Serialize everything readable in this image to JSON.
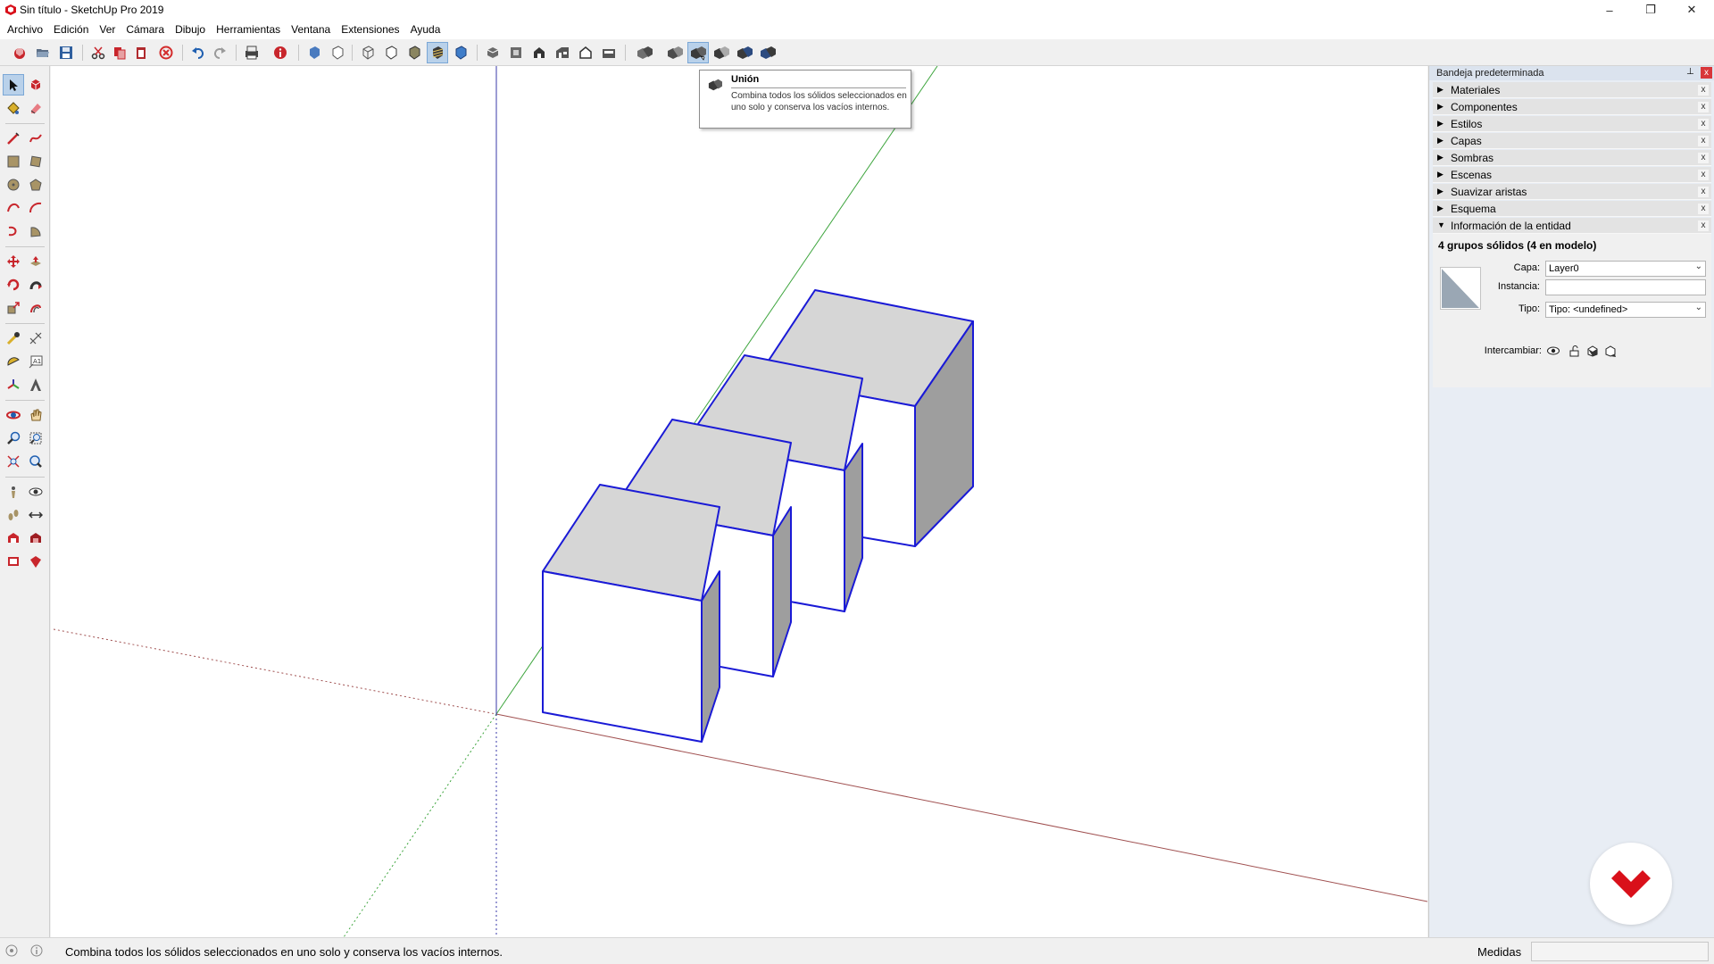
{
  "window": {
    "title": "Sin título - SketchUp Pro 2019",
    "controls": {
      "minimize": "–",
      "maximize": "❐",
      "close": "✕"
    }
  },
  "menu": [
    "Archivo",
    "Edición",
    "Ver",
    "Cámara",
    "Dibujo",
    "Herramientas",
    "Ventana",
    "Extensiones",
    "Ayuda"
  ],
  "toolbar": {
    "icons": [
      "new-model-icon",
      "open-folder-icon",
      "save-icon",
      "cut-icon",
      "copy-icon",
      "paste-icon",
      "erase-icon",
      "undo-icon",
      "redo-icon",
      "print-icon",
      "model-info-icon",
      "xray-icon",
      "back-edges-icon",
      "wireframe-icon",
      "hidden-line-icon",
      "shaded-icon",
      "shaded-textures-icon",
      "iso-view-icon",
      "top-view-icon",
      "front-view-icon",
      "right-view-icon",
      "back-view-icon",
      "left-view-icon",
      "outer-shell-icon",
      "intersect-icon",
      "union-icon",
      "subtract-icon",
      "trim-icon",
      "split-icon"
    ],
    "active": [
      "shaded-textures-icon",
      "union-icon"
    ]
  },
  "tooltip": {
    "title": "Unión",
    "description": "Combina todos los sólidos seleccionados en uno solo y conserva los vacíos internos."
  },
  "tray": {
    "title": "Bandeja predeterminada",
    "pin": "📌",
    "close": "x",
    "panels": [
      {
        "label": "Materiales",
        "expanded": false
      },
      {
        "label": "Componentes",
        "expanded": false
      },
      {
        "label": "Estilos",
        "expanded": false
      },
      {
        "label": "Capas",
        "expanded": false
      },
      {
        "label": "Sombras",
        "expanded": false
      },
      {
        "label": "Escenas",
        "expanded": false
      },
      {
        "label": "Suavizar aristas",
        "expanded": false
      },
      {
        "label": "Esquema",
        "expanded": false
      },
      {
        "label": "Información de la entidad",
        "expanded": true
      }
    ],
    "panel_close": "x",
    "entity_info": {
      "heading": "4 grupos sólidos (4 en modelo)",
      "layer_label": "Capa:",
      "layer_value": "Layer0",
      "instance_label": "Instancia:",
      "instance_value": "",
      "type_label": "Tipo:",
      "type_value": "Tipo: <undefined>",
      "toggles_label": "Intercambiar:"
    }
  },
  "status": {
    "hint": "Combina todos los sólidos seleccionados en uno solo y conserva los vacíos internos.",
    "measurements_label": "Medidas",
    "measurements_value": ""
  },
  "colors": {
    "selection_edge": "#1a1ad6",
    "top_face": "#d6d6d6",
    "side_face": "#9e9e9e",
    "front_face": "#ffffff",
    "axis_red": "#a05050",
    "axis_green": "#3da53d",
    "axis_blue": "#3a3aa8",
    "brand": "#d9101a"
  }
}
